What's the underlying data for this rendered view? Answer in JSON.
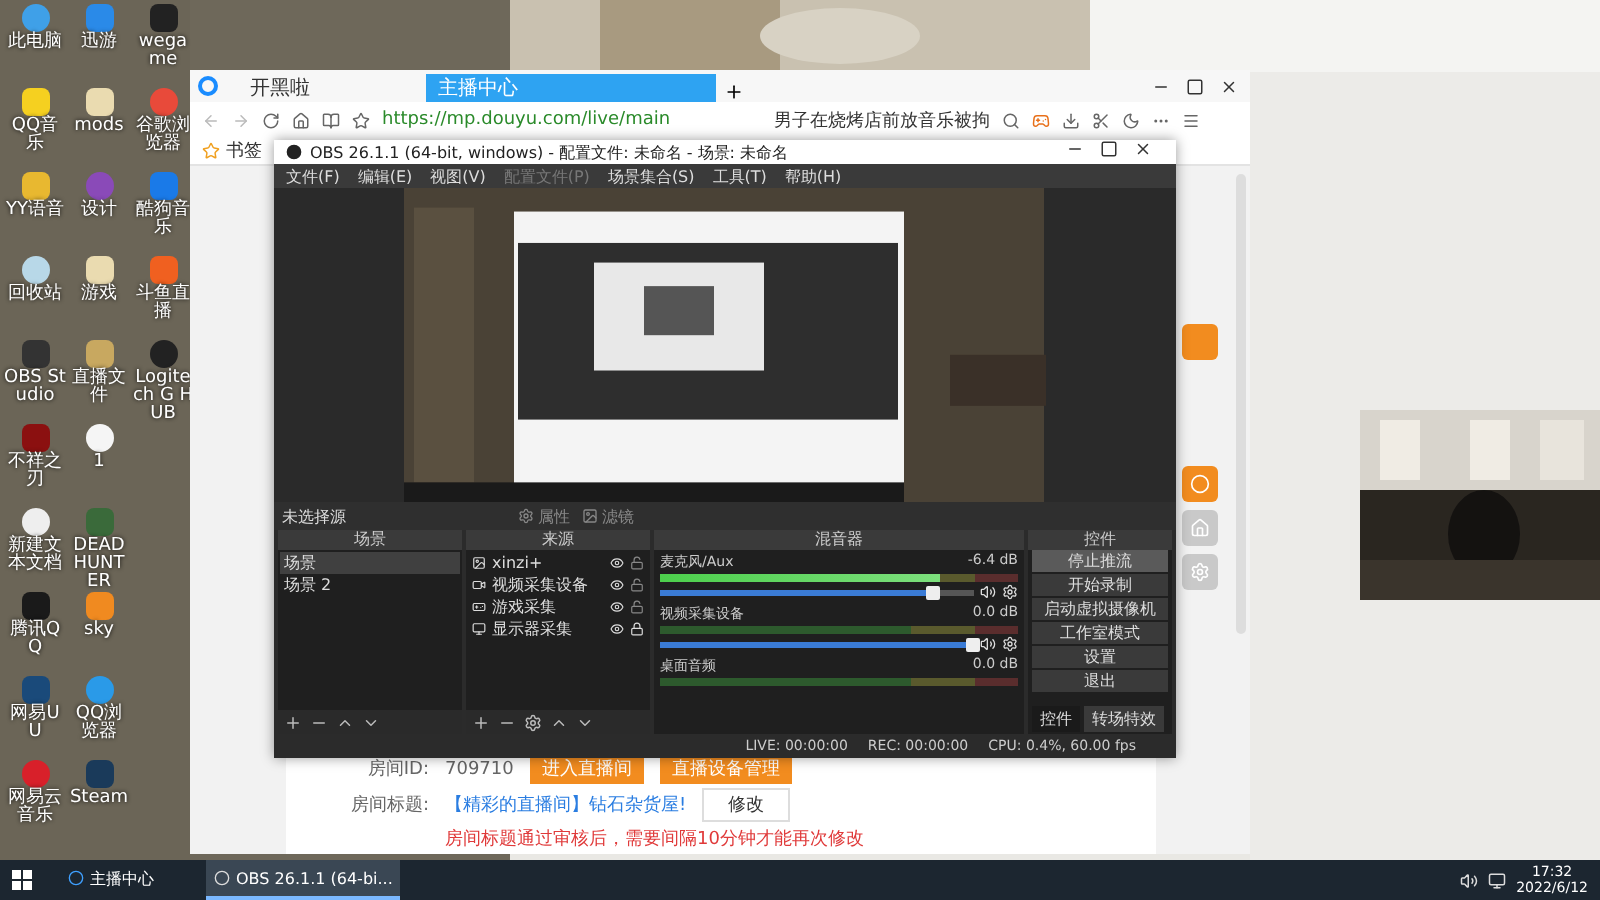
{
  "desktop": {
    "icons": [
      {
        "label": "此电脑"
      },
      {
        "label": "QQ音乐"
      },
      {
        "label": "YY语音"
      },
      {
        "label": "回收站"
      },
      {
        "label": "OBS Studio"
      },
      {
        "label": "不祥之刃"
      },
      {
        "label": "新建文本文档"
      },
      {
        "label": "腾讯QQ"
      },
      {
        "label": "网易UU"
      },
      {
        "label": "网易云音乐"
      },
      {
        "label": "迅游"
      },
      {
        "label": "mods"
      },
      {
        "label": "设计"
      },
      {
        "label": "游戏"
      },
      {
        "label": "直播文件"
      },
      {
        "label": "1"
      },
      {
        "label": "DEAD HUNTER"
      },
      {
        "label": "sky"
      },
      {
        "label": "QQ浏览器"
      },
      {
        "label": "Steam"
      },
      {
        "label": "wegame"
      },
      {
        "label": "谷歌浏览器"
      },
      {
        "label": "酷狗音乐"
      },
      {
        "label": "斗鱼直播"
      },
      {
        "label": "Logitech G HUB"
      }
    ]
  },
  "browser": {
    "tabs": [
      {
        "label": "开黑啦",
        "selected": false
      },
      {
        "label": "主播中心",
        "selected": true
      }
    ],
    "address": "https://mp.douyu.com/live/main",
    "search": "男子在烧烤店前放音乐被拘",
    "bookmark": "书签",
    "room": {
      "id_label": "房间ID:",
      "id": "709710",
      "buttons": [
        "进入直播间",
        "直播设备管理"
      ],
      "title_label": "房间标题:",
      "title": "【精彩的直播间】钻石杂货屋!",
      "edit_button": "修改",
      "note": "房间标题通过审核后，需要间隔10分钟才能再次修改"
    }
  },
  "obs": {
    "title": "OBS 26.1.1 (64-bit, windows) - 配置文件: 未命名 - 场景: 未命名",
    "menu": [
      {
        "label": "文件(F)",
        "disabled": false
      },
      {
        "label": "编辑(E)",
        "disabled": false
      },
      {
        "label": "视图(V)",
        "disabled": false
      },
      {
        "label": "配置文件(P)",
        "disabled": true
      },
      {
        "label": "场景集合(S)",
        "disabled": false
      },
      {
        "label": "工具(T)",
        "disabled": false
      },
      {
        "label": "帮助(H)",
        "disabled": false
      }
    ],
    "source_status": "未选择源",
    "source_buttons": [
      {
        "label": "属性",
        "disabled": true
      },
      {
        "label": "滤镜",
        "disabled": true
      }
    ],
    "scenes": {
      "title": "场景",
      "items": [
        {
          "label": "场景",
          "selected": true
        },
        {
          "label": "场景 2",
          "selected": false
        }
      ]
    },
    "sources": {
      "title": "来源",
      "items": [
        {
          "label": "xinzi+",
          "visible": true,
          "locked": false
        },
        {
          "label": "视频采集设备",
          "visible": true,
          "locked": false
        },
        {
          "label": "游戏采集",
          "visible": true,
          "locked": false
        },
        {
          "label": "显示器采集",
          "visible": true,
          "locked": true
        }
      ]
    },
    "mixer": {
      "title": "混音器",
      "channels": [
        {
          "name": "麦克风/Aux",
          "reading": "-6.4 dB",
          "meter": {
            "level": 0.78
          },
          "level": 0.87
        },
        {
          "name": "视频采集设备",
          "reading": "0.0 dB",
          "level": 1
        },
        {
          "name": "桌面音频",
          "reading": "0.0 dB"
        }
      ]
    },
    "controls": {
      "title": "控件",
      "buttons": [
        {
          "label": "停止推流",
          "active": true
        },
        {
          "label": "开始录制",
          "active": false
        },
        {
          "label": "启动虚拟摄像机",
          "active": false
        },
        {
          "label": "工作室模式",
          "active": false
        },
        {
          "label": "设置",
          "active": false
        },
        {
          "label": "退出",
          "active": false
        }
      ],
      "tabs": [
        {
          "label": "控件",
          "selected": true
        },
        {
          "label": "转场特效",
          "selected": false
        }
      ]
    },
    "status": {
      "live": "LIVE: 00:00:00",
      "rec": "REC: 00:00:00",
      "cpu": "CPU: 0.4%, 60.00 fps"
    }
  },
  "taskbar": {
    "apps": [
      {
        "label": "主播中心",
        "active": false
      },
      {
        "label": "OBS 26.1.1 (64-bi...",
        "active": true
      }
    ],
    "time": "17:32",
    "date": "2022/6/12"
  }
}
